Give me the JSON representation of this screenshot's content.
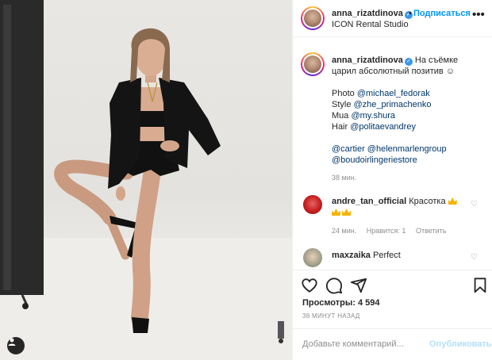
{
  "header": {
    "username": "anna_rizatdinova",
    "verified_mark": "✓",
    "dot": "•",
    "follow_label": "Подписаться",
    "location": "ICON Rental Studio",
    "more_icon": "ellipsis-icon",
    "more_label": "•••"
  },
  "caption": {
    "username": "anna_rizatdinova",
    "verified_mark": "✓",
    "text": "На съёмке царил абсолютный позитив ☺",
    "credits": [
      {
        "prefix": "Photo ",
        "handle": "@michael_fedorak"
      },
      {
        "prefix": "Style ",
        "handle": "@zhe_primachenko"
      },
      {
        "prefix": "Mua ",
        "handle": "@my.shura"
      },
      {
        "prefix": "Hair ",
        "handle": "@politaevandrey"
      }
    ],
    "brands_line1_a": "@cartier",
    "brands_line1_b": "@helenmarlengroup",
    "brands_line2": "@boudoirlingeriestore",
    "time": "38 мин."
  },
  "comments": [
    {
      "username": "andre_tan_official",
      "text": "Красотка",
      "emoji": "crown-emoji",
      "time": "24 мин.",
      "likes": "Нравится: 1",
      "reply": "Ответить"
    },
    {
      "username": "maxzaika",
      "text": "Perfect"
    }
  ],
  "actions": {
    "like_icon": "heart-icon",
    "comment_icon": "comment-icon",
    "share_icon": "share-icon",
    "save_icon": "bookmark-icon"
  },
  "views": "Просмотры: 4 594",
  "post_time": "38 МИНУТ НАЗАД",
  "add_comment": {
    "placeholder": "Добавьте комментарий...",
    "publish_label": "Опубликовать"
  },
  "colors": {
    "accent": "#0095f6",
    "link": "#00376b",
    "muted": "#8e8e8e",
    "text": "#262626"
  }
}
